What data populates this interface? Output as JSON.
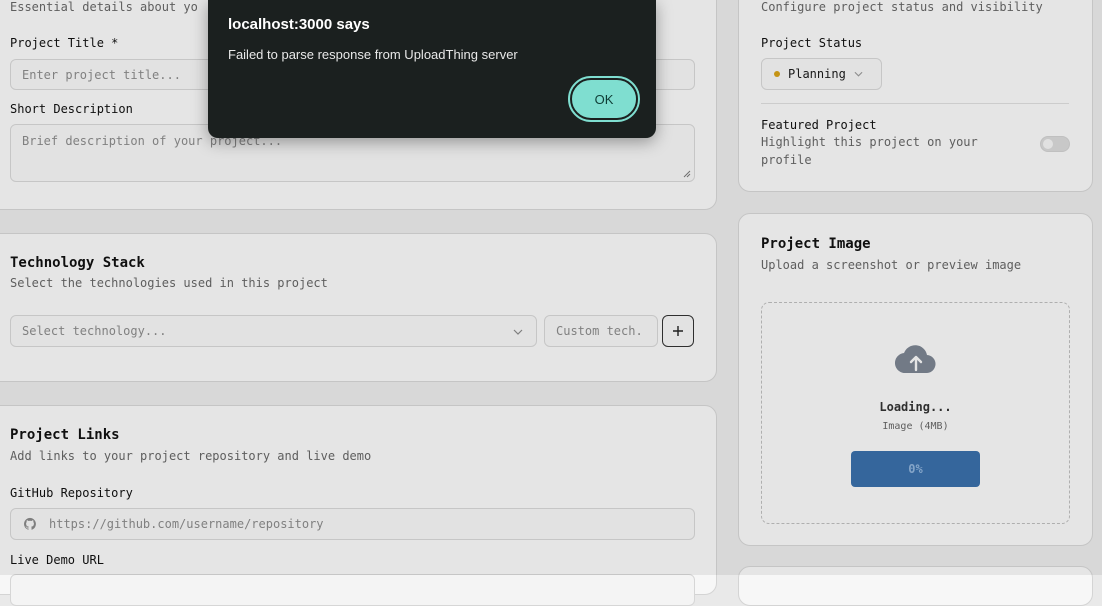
{
  "dialog": {
    "title": "localhost:3000 says",
    "message": "Failed to parse response from UploadThing server",
    "ok_label": "OK"
  },
  "basic_info": {
    "subtitle": "Essential details about yo",
    "title_label": "Project Title *",
    "title_placeholder": "Enter project title...",
    "description_label": "Short Description",
    "description_placeholder": "Brief description of your project..."
  },
  "tech_stack": {
    "title": "Technology Stack",
    "subtitle": "Select the technologies used in this project",
    "select_placeholder": "Select technology...",
    "custom_placeholder": "Custom tech.",
    "add_icon": "plus-icon"
  },
  "links": {
    "title": "Project Links",
    "subtitle": "Add links to your project repository and live demo",
    "github_label": "GitHub Repository",
    "github_placeholder": "https://github.com/username/repository",
    "github_icon": "github-icon",
    "demo_label": "Live Demo URL"
  },
  "settings": {
    "subtitle": "Configure project status and visibility",
    "status_label": "Project Status",
    "status_value": "Planning",
    "status_color": "#d4a017",
    "featured_label": "Featured Project",
    "featured_desc_line1": "Highlight this project on your",
    "featured_desc_line2": "profile",
    "featured_enabled": false
  },
  "image": {
    "title": "Project Image",
    "subtitle": "Upload a screenshot or preview image",
    "upload_icon": "cloud-upload-icon",
    "loading_text": "Loading...",
    "file_hint": "Image (4MB)",
    "progress_text": "0%",
    "progress": 0
  },
  "colors": {
    "dialog_bg": "#1b201f",
    "ok_button": "#7fded0",
    "progress_bar": "#3a6ea8"
  }
}
